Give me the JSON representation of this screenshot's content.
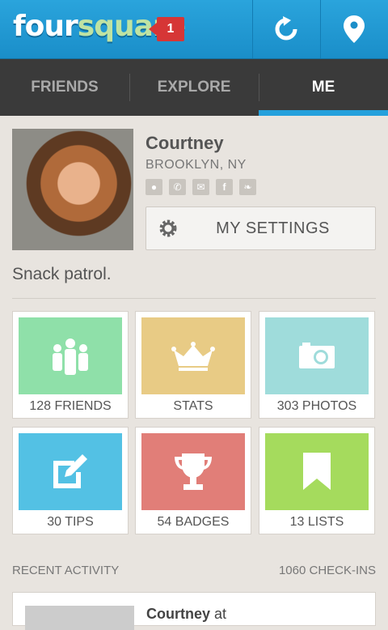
{
  "app": {
    "logo": "foursquare",
    "notification_count": "1",
    "accent": "#1a8ec9",
    "actions": [
      "refresh-icon",
      "location-pin-icon"
    ]
  },
  "tabs": [
    {
      "label": "FRIENDS"
    },
    {
      "label": "EXPLORE"
    },
    {
      "label": "ME",
      "active": true
    }
  ],
  "profile": {
    "name": "Courtney",
    "location": "BROOKLYN, NY",
    "contact_icons": [
      "chat-icon",
      "phone-icon",
      "email-icon",
      "facebook-icon",
      "twitter-icon"
    ],
    "settings_label": "MY SETTINGS",
    "bio": "Snack patrol."
  },
  "tiles": [
    {
      "label": "128 FRIENDS",
      "color": "#8fe0a9",
      "icon": "friends-icon"
    },
    {
      "label": "STATS",
      "color": "#e8cb85",
      "icon": "crown-icon"
    },
    {
      "label": "303 PHOTOS",
      "color": "#9fdcdb",
      "icon": "camera-icon"
    },
    {
      "label": "30 TIPS",
      "color": "#53c1e4",
      "icon": "edit-icon"
    },
    {
      "label": "54 BADGES",
      "color": "#e17e78",
      "icon": "trophy-icon"
    },
    {
      "label": "13 LISTS",
      "color": "#a5db5d",
      "icon": "bookmark-icon"
    }
  ],
  "recent": {
    "heading": "RECENT ACTIVITY",
    "count": "1060 CHECK-INS",
    "first_item_name": "Courtney",
    "first_item_suffix": " at"
  }
}
